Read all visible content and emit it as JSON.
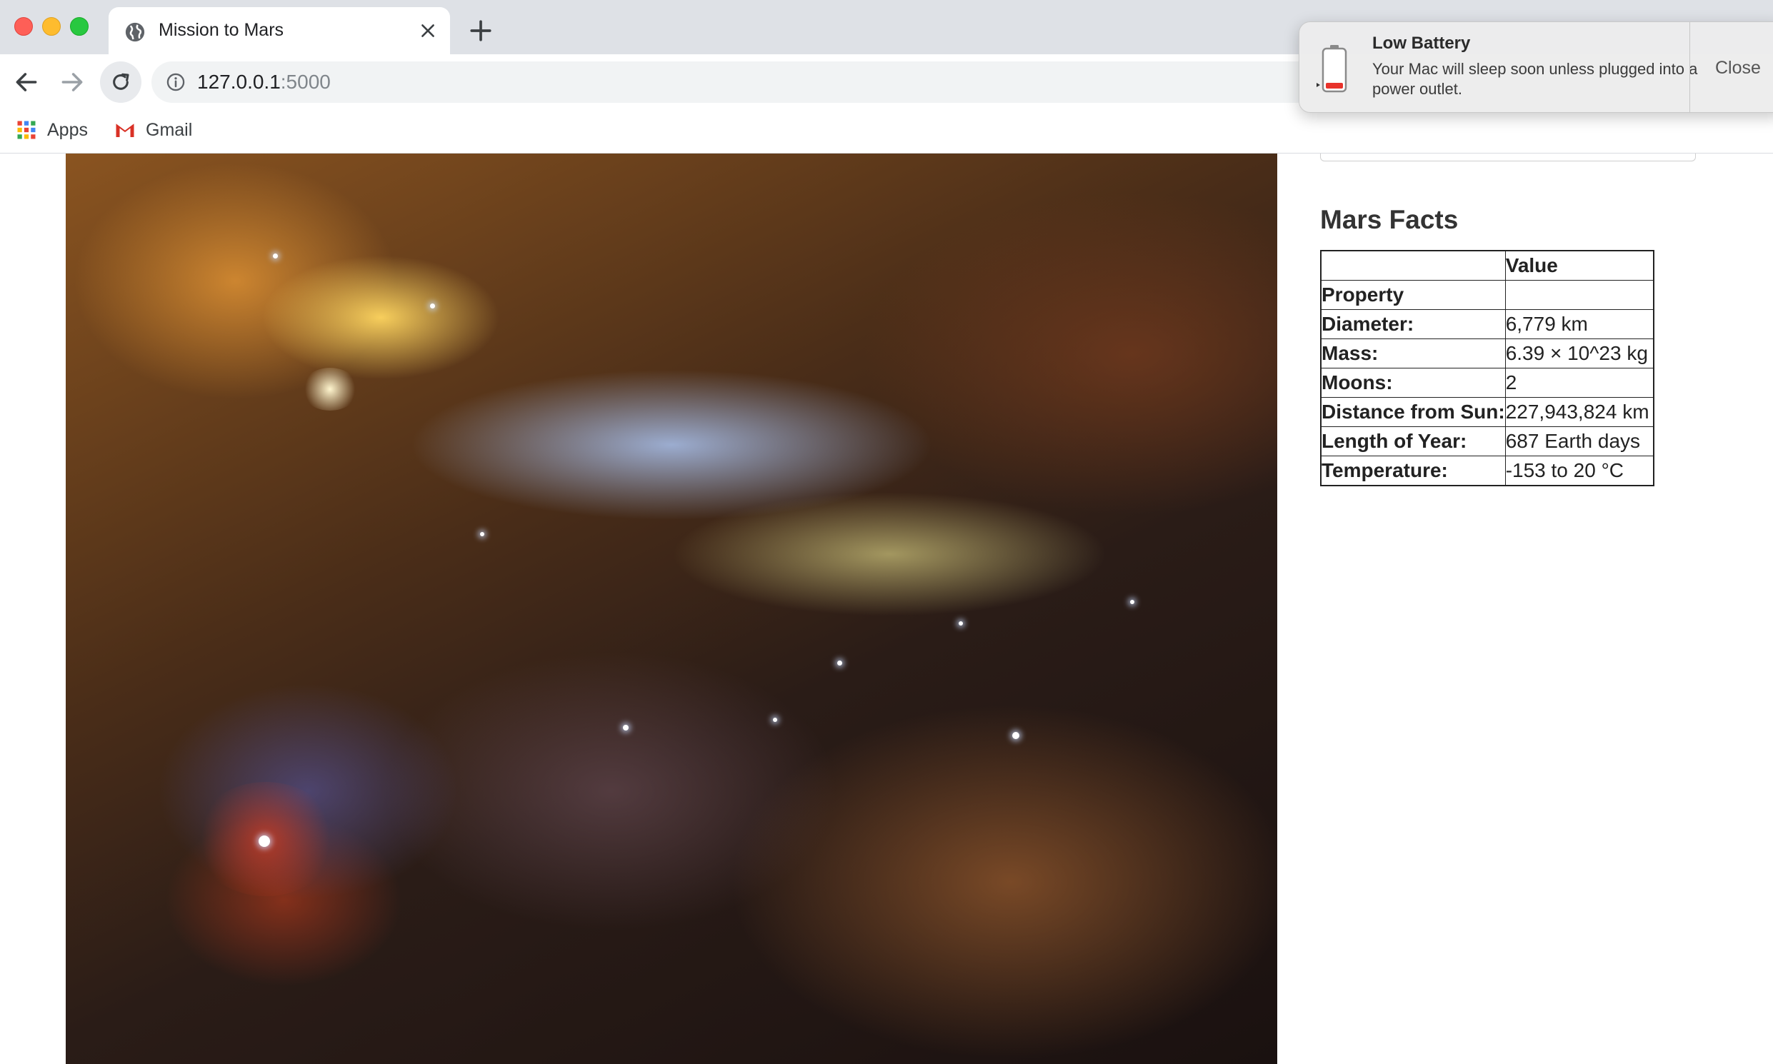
{
  "browser": {
    "tab_title": "Mission to Mars",
    "url_host": "127.0.0.1",
    "url_port": ":5000",
    "bookmarks": [
      {
        "label": "Apps",
        "icon": "apps-grid-icon"
      },
      {
        "label": "Gmail",
        "icon": "gmail-icon"
      }
    ]
  },
  "notification": {
    "title": "Low Battery",
    "body": "Your Mac will sleep soon unless plugged into a power outlet.",
    "close_label": "Close",
    "icon": "battery-low-icon"
  },
  "page": {
    "hero_image": "nebula-image",
    "facts_heading": "Mars Facts",
    "facts_table": {
      "header_blank": "",
      "header_value": "Value",
      "index_label": "Property",
      "rows": [
        {
          "property": "Diameter:",
          "value": "6,779 km"
        },
        {
          "property": "Mass:",
          "value": "6.39 × 10^23 kg"
        },
        {
          "property": "Moons:",
          "value": "2"
        },
        {
          "property": "Distance from Sun:",
          "value": "227,943,824 km"
        },
        {
          "property": "Length of Year:",
          "value": "687 Earth days"
        },
        {
          "property": "Temperature:",
          "value": "-153 to 20 °C"
        }
      ]
    }
  },
  "colors": {
    "traffic_red": "#fe5f57",
    "traffic_yellow": "#febc2e",
    "traffic_green": "#28c840",
    "battery_low": "#e8322b"
  }
}
